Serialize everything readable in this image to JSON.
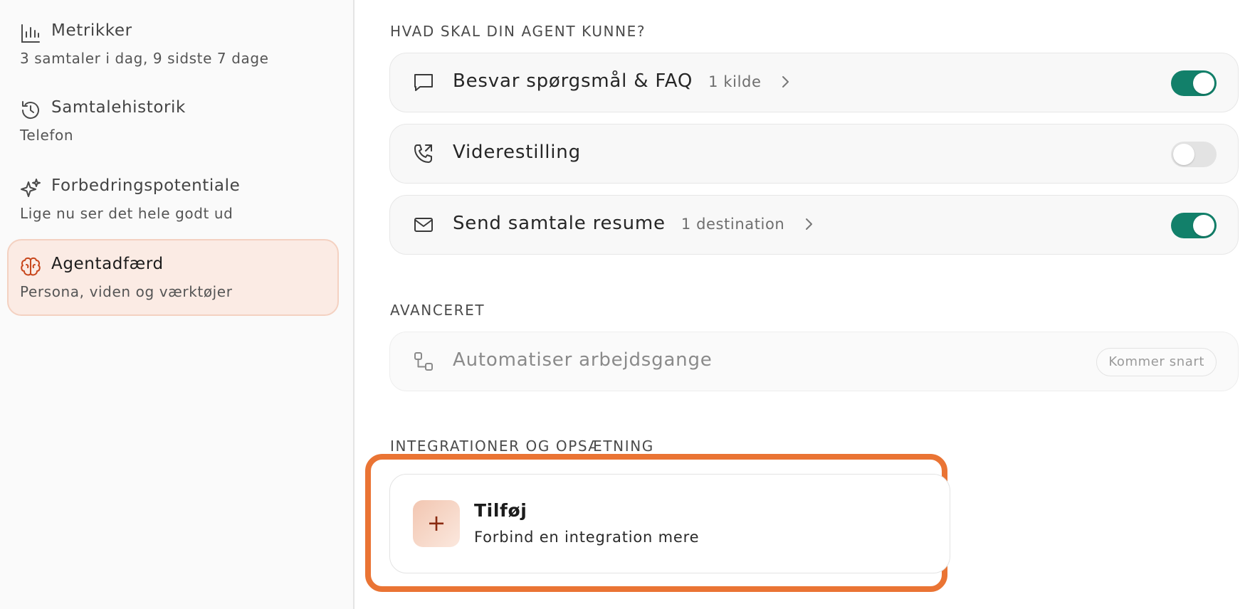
{
  "sidebar": {
    "items": [
      {
        "icon": "bar-chart-icon",
        "title": "Metrikker",
        "subtitle": "3 samtaler i dag, 9 sidste 7 dage",
        "active": false
      },
      {
        "icon": "history-icon",
        "title": "Samtalehistorik",
        "subtitle": "Telefon",
        "active": false
      },
      {
        "icon": "sparkles-icon",
        "title": "Forbedringspotentiale",
        "subtitle": "Lige nu ser det hele godt ud",
        "active": false
      },
      {
        "icon": "brain-icon",
        "title": "Agentadfærd",
        "subtitle": "Persona, viden og værktøjer",
        "active": true
      }
    ]
  },
  "capabilities": {
    "heading": "HVAD SKAL DIN AGENT KUNNE?",
    "items": [
      {
        "icon": "chat-bubble-icon",
        "label": "Besvar spørgsmål & FAQ",
        "meta": "1 kilde",
        "enabled": true
      },
      {
        "icon": "phone-forward-icon",
        "label": "Viderestilling",
        "meta": "",
        "enabled": false
      },
      {
        "icon": "mail-icon",
        "label": "Send samtale resume",
        "meta": "1 destination",
        "enabled": true
      }
    ]
  },
  "advanced": {
    "heading": "AVANCERET",
    "items": [
      {
        "icon": "workflow-icon",
        "label": "Automatiser arbejdsgange",
        "badge": "Kommer snart"
      }
    ]
  },
  "integrations": {
    "heading": "INTEGRATIONER OG OPSÆTNING",
    "add": {
      "icon": "plus-icon",
      "title": "Tilføj",
      "subtitle": "Forbind en integration mere"
    }
  },
  "colors": {
    "accent": "#ea7434",
    "toggle_on": "#12806a",
    "active_nav_bg": "#fbebe4",
    "active_icon": "#c8471c"
  }
}
